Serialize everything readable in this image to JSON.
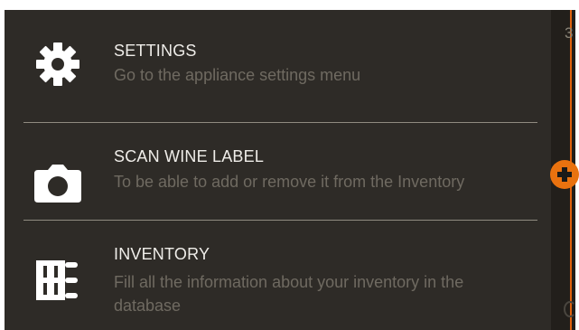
{
  "side_panel": {
    "number": "3"
  },
  "menu": {
    "items": [
      {
        "icon": "gear-icon",
        "title": "SETTINGS",
        "description": "Go to the appliance settings menu"
      },
      {
        "icon": "camera-icon",
        "title": "SCAN WINE LABEL",
        "description": "To be able to add or remove it from the Inventory"
      },
      {
        "icon": "inventory-icon",
        "title": "INVENTORY",
        "description": "Fill all the information about your inventory in the database"
      }
    ]
  },
  "colors": {
    "background": "#2e2b27",
    "accent": "#e9720f",
    "title_text": "#efede9",
    "description_text": "#6f6a61"
  }
}
